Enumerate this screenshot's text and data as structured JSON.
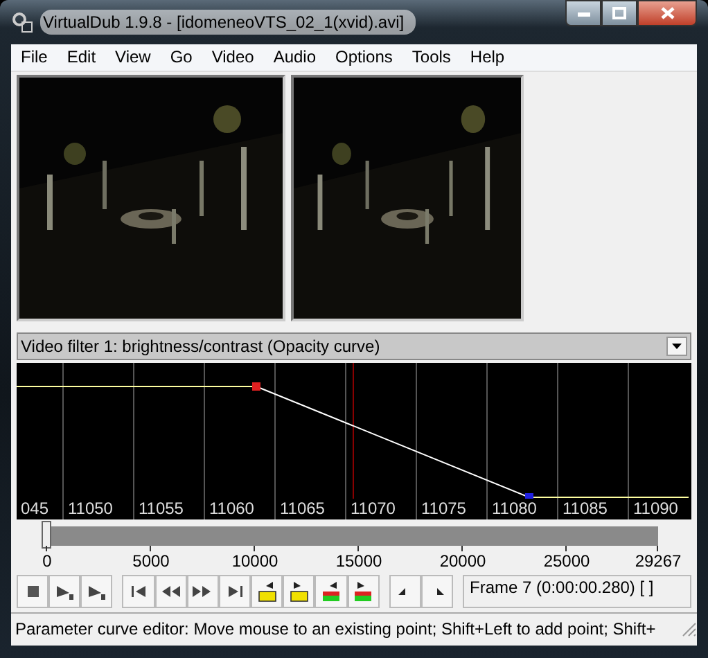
{
  "window": {
    "title": "VirtualDub 1.9.8 - [idomeneoVTS_02_1(xvid).avi]"
  },
  "menu": [
    "File",
    "Edit",
    "View",
    "Go",
    "Video",
    "Audio",
    "Options",
    "Tools",
    "Help"
  ],
  "panes": [
    {
      "kind": "picture"
    },
    {
      "kind": "picture"
    }
  ],
  "filter_select": {
    "value": "Video filter 1: brightness/contrast (Opacity curve)"
  },
  "curve_editor": {
    "frame_labels": [
      "045",
      "11050",
      "11055",
      "11060",
      "11065",
      "11070",
      "11075",
      "11080",
      "11085",
      "11090"
    ]
  },
  "position": {
    "level": 0,
    "ticks": [
      "0",
      "5000",
      "10000",
      "15000",
      "20000",
      "25000",
      "29267"
    ]
  },
  "toolbar": [
    {
      "kind": "stop"
    },
    {
      "kind": "play-input"
    },
    {
      "kind": "play-output"
    },
    {
      "kind": "start"
    },
    {
      "kind": "back"
    },
    {
      "kind": "forward"
    },
    {
      "kind": "end"
    },
    {
      "kind": "prev-key"
    },
    {
      "kind": "next-key"
    },
    {
      "kind": "prev-scene"
    },
    {
      "kind": "next-scene"
    },
    {
      "kind": "mark-in"
    },
    {
      "kind": "mark-out"
    }
  ],
  "frame_field": {
    "value": "Frame 7 (0:00:00.280) [ ]"
  },
  "status_bar": {
    "text": "Parameter curve editor: Move mouse to an existing point; Shift+Left to add point; Shift+"
  }
}
